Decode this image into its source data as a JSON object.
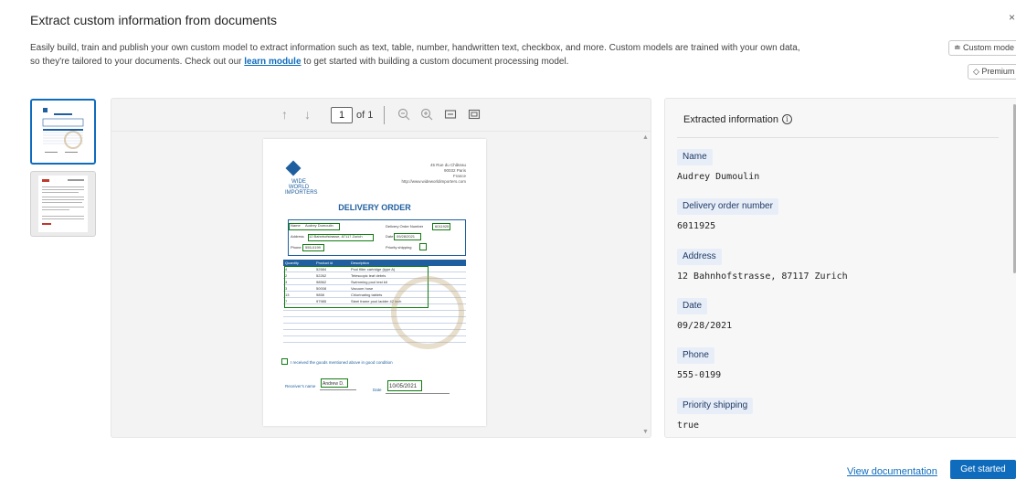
{
  "dialog": {
    "title": "Extract custom information from documents",
    "close_glyph": "×",
    "description_before_link": "Easily build, train and publish your own custom model to extract information such as text, table, number, handwritten text, checkbox, and more. Custom models are trained with your own data, so they're tailored to your documents. Check out our",
    "link_text": "learn module",
    "description_after_link": "to get started with building a custom document processing model."
  },
  "badges": {
    "custom_model": "≐ Custom mode",
    "premium": "◇ Premium"
  },
  "viewer": {
    "page_current": "1",
    "page_of": "of 1",
    "icons": [
      "arrow-up-icon",
      "arrow-down-icon",
      "zoom-out-icon",
      "zoom-in-icon",
      "fit-width-icon",
      "fit-page-icon"
    ]
  },
  "document": {
    "company": "WIDE WORLD IMPORTERS",
    "address_lines": [
      "45 Rue du Château",
      "90032 Paris",
      "France",
      "http://www.wideworldimporters.com"
    ],
    "title": "DELIVERY ORDER",
    "fields": {
      "name_label": "Name",
      "name_value": "Audrey Dumoulin",
      "address_label": "Address",
      "address_value": "12 Bahnhofstrasse, 87117 Zurich",
      "phone_label": "Phone",
      "phone_value": "555-0199",
      "order_label": "Delivery Order Number",
      "order_value": "6011925",
      "date_label": "Date",
      "date_value": "09/28/2021",
      "priority_label": "Priority shipping"
    },
    "table_headers": [
      "Quantity",
      "Product id",
      "Description"
    ],
    "table_rows": [
      [
        "4",
        "52584",
        "Pool filter cartridge (type A)"
      ],
      [
        "2",
        "52262",
        "Telescopic leaf debris"
      ],
      [
        "3",
        "98562",
        "Swimming pool test kit"
      ],
      [
        "3",
        "50008",
        "Vacuum hose"
      ],
      [
        "13",
        "9858",
        "Chlorinating tablets"
      ],
      [
        "7",
        "97985",
        "Steel frame pool ladder 42 inch"
      ]
    ],
    "footer_checkbox_text": "I received the goods mentioned above in good condition",
    "receiver_label": "Receiver's name",
    "receiver_value": "Andrew D.",
    "sig_date_label": "Date",
    "sig_date_value": "10/05/2021"
  },
  "panel": {
    "title": "Extracted information",
    "info_glyph": "i",
    "fields": [
      {
        "label": "Name",
        "value": "Audrey Dumoulin"
      },
      {
        "label": "Delivery order number",
        "value": "6011925"
      },
      {
        "label": "Address",
        "value": "12 Bahnhofstrasse, 87117 Zurich"
      },
      {
        "label": "Date",
        "value": "09/28/2021"
      },
      {
        "label": "Phone",
        "value": "555-0199"
      },
      {
        "label": "Priority shipping",
        "value": "true"
      }
    ]
  },
  "footer": {
    "view_docs": "View documentation",
    "get_started": "Get started"
  },
  "colors": {
    "accent": "#0f6cbd",
    "doc_blue": "#1f5f9f",
    "detection_green": "#107c10",
    "label_bg": "#e8eef8"
  }
}
